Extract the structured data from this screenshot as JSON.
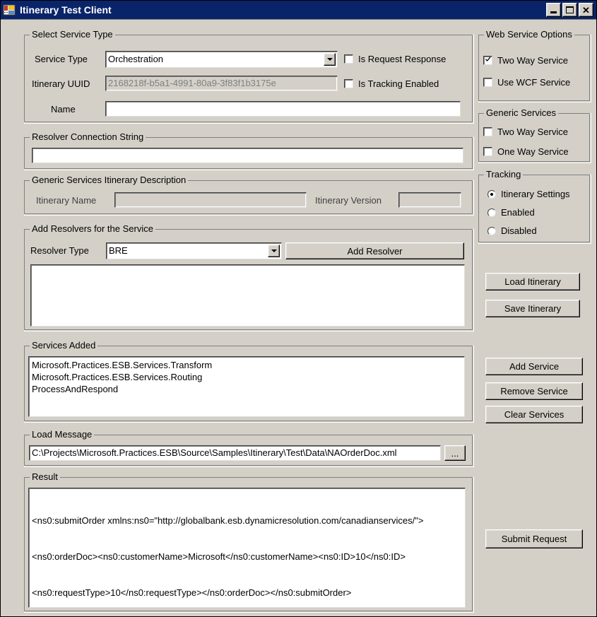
{
  "window": {
    "title": "Itinerary Test Client",
    "icon": "application-icon",
    "minimize_label": "Minimize",
    "maximize_label": "Maximize",
    "close_label": "Close"
  },
  "colors": {
    "titlebar": "#0a246a",
    "face": "#d4d0c8",
    "field": "#ffffff",
    "text": "#000000",
    "disabled_text": "#808080"
  },
  "select_service_type": {
    "group_title": "Select Service Type",
    "service_type_label": "Service Type",
    "service_type_value": "Orchestration",
    "itinerary_uuid_label": "Itinerary UUID",
    "itinerary_uuid_value": "2168218f-b5a1-4991-80a9-3f83f1b3175e",
    "name_label": "Name",
    "name_value": "",
    "is_request_response_label": "Is Request Response",
    "is_request_response_checked": false,
    "is_tracking_enabled_label": "Is Tracking Enabled",
    "is_tracking_enabled_checked": false
  },
  "resolver_connection_string": {
    "group_title": "Resolver Connection String",
    "value": ""
  },
  "generic_services_itinerary_description": {
    "group_title": "Generic Services Itinerary Description",
    "itinerary_name_label": "Itinerary Name",
    "itinerary_name_value": "",
    "itinerary_version_label": "Itinerary Version",
    "itinerary_version_value": ""
  },
  "add_resolvers": {
    "group_title": "Add Resolvers for the Service",
    "resolver_type_label": "Resolver Type",
    "resolver_type_value": "BRE",
    "add_resolver_button": "Add Resolver",
    "resolver_list_items": []
  },
  "services_added": {
    "group_title": "Services Added",
    "items": [
      "Microsoft.Practices.ESB.Services.Transform",
      "Microsoft.Practices.ESB.Services.Routing",
      "ProcessAndRespond"
    ]
  },
  "load_message": {
    "group_title": "Load Message",
    "path_value": "C:\\Projects\\Microsoft.Practices.ESB\\Source\\Samples\\Itinerary\\Test\\Data\\NAOrderDoc.xml",
    "browse_button": "..."
  },
  "result": {
    "group_title": "Result",
    "lines": [
      "<ns0:submitOrder xmlns:ns0=\"http://globalbank.esb.dynamicresolution.com/canadianservices/\">",
      "<ns0:orderDoc><ns0:customerName>Microsoft</ns0:customerName><ns0:ID>10</ns0:ID>",
      "<ns0:requestType>10</ns0:requestType></ns0:orderDoc></ns0:submitOrder>"
    ]
  },
  "web_service_options": {
    "group_title": "Web Service Options",
    "two_way_service_label": "Two Way Service",
    "two_way_service_checked": true,
    "use_wcf_service_label": "Use WCF Service",
    "use_wcf_service_checked": false
  },
  "generic_services": {
    "group_title": "Generic Services",
    "two_way_service_label": "Two Way Service",
    "two_way_service_checked": false,
    "one_way_service_label": "One Way Service",
    "one_way_service_checked": false
  },
  "tracking": {
    "group_title": "Tracking",
    "options": [
      {
        "label": "Itinerary Settings",
        "selected": true
      },
      {
        "label": "Enabled",
        "selected": false
      },
      {
        "label": "Disabled",
        "selected": false
      }
    ]
  },
  "buttons": {
    "load_itinerary": "Load Itinerary",
    "save_itinerary": "Save Itinerary",
    "add_service": "Add Service",
    "remove_service": "Remove Service",
    "clear_services": "Clear Services",
    "submit_request": "Submit Request"
  }
}
